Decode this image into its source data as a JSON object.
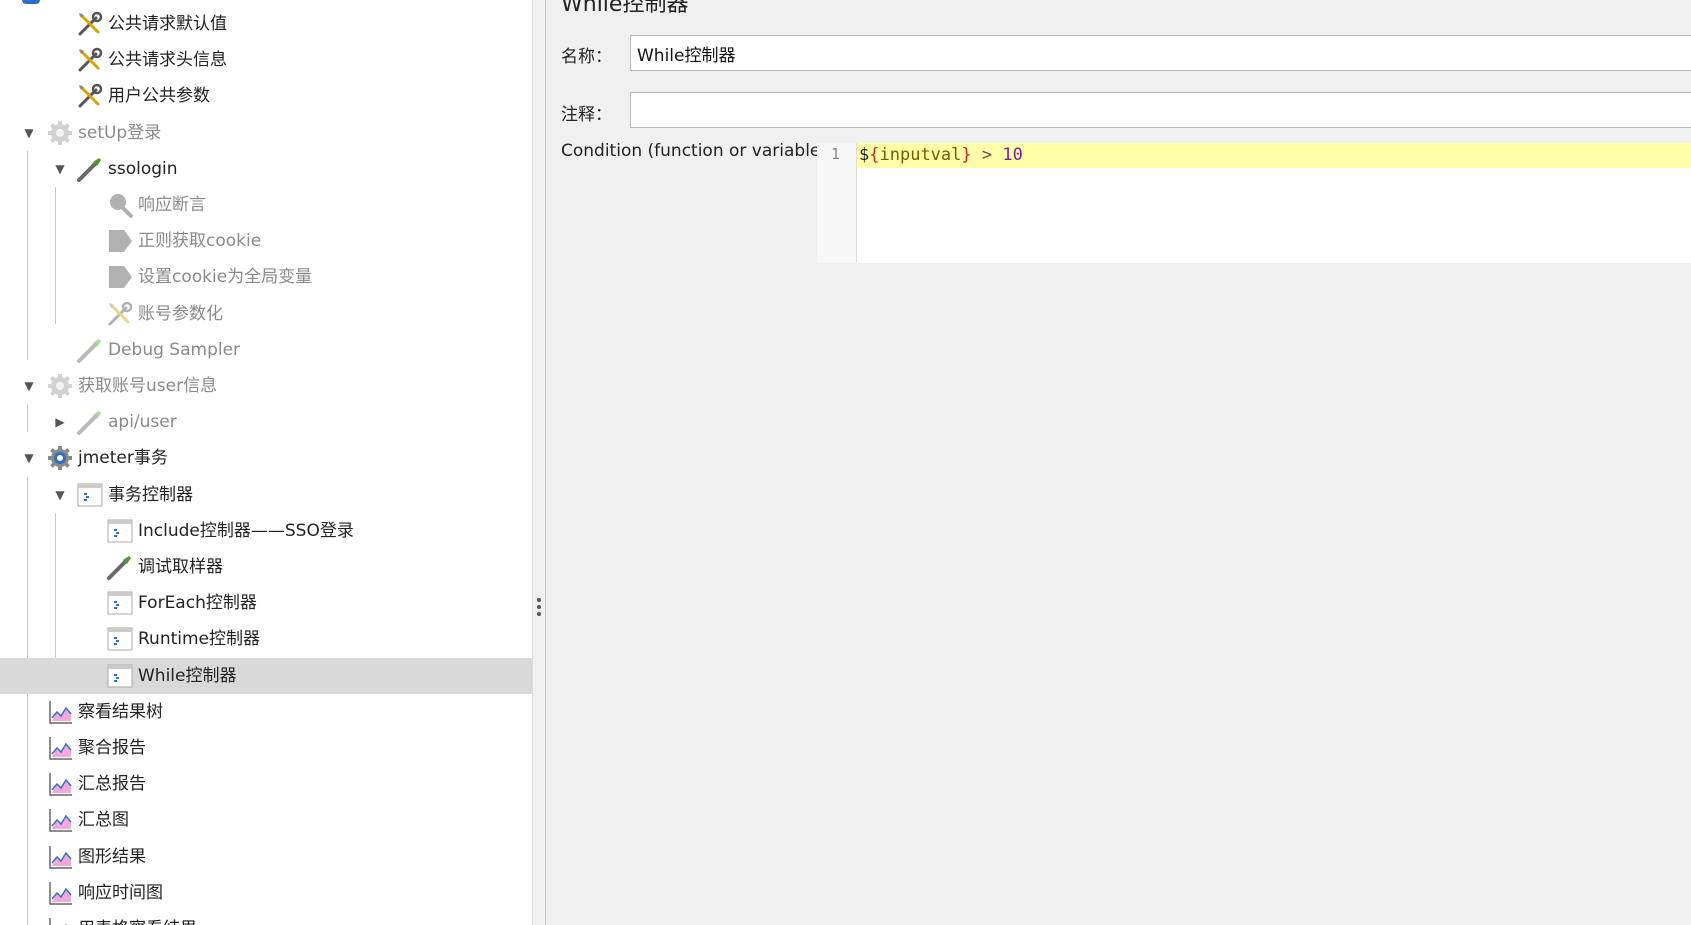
{
  "tree": {
    "nodes": [
      {
        "label": "公共请求默认值",
        "icon": "wrench-screwdriver-icon",
        "level": 1
      },
      {
        "label": "公共请求头信息",
        "icon": "wrench-screwdriver-icon",
        "level": 1
      },
      {
        "label": "用户公共参数",
        "icon": "wrench-screwdriver-icon",
        "level": 1
      },
      {
        "label": "setUp登录",
        "icon": "gear-icon",
        "level": 0,
        "expanded": true,
        "disabled": true
      },
      {
        "label": "ssologin",
        "icon": "pipette-icon",
        "level": 1,
        "expanded": true
      },
      {
        "label": "响应断言",
        "icon": "magnifier-icon",
        "level": 2,
        "disabled": true
      },
      {
        "label": "正则获取cookie",
        "icon": "tag-icon",
        "level": 2,
        "disabled": true
      },
      {
        "label": "设置cookie为全局变量",
        "icon": "tag-icon",
        "level": 2,
        "disabled": true
      },
      {
        "label": "账号参数化",
        "icon": "wrench-screwdriver-icon",
        "level": 2,
        "disabled": true
      },
      {
        "label": "Debug Sampler",
        "icon": "pipette-icon",
        "level": 1,
        "disabled": true
      },
      {
        "label": "获取账号user信息",
        "icon": "gear-icon",
        "level": 0,
        "expanded": true,
        "disabled": true
      },
      {
        "label": "api/user",
        "icon": "pipette-icon",
        "level": 1,
        "collapsed": true,
        "disabled": true
      },
      {
        "label": "jmeter事务",
        "icon": "gear-icon",
        "level": 0,
        "expanded": true
      },
      {
        "label": "事务控制器",
        "icon": "controller-icon",
        "level": 1,
        "expanded": true
      },
      {
        "label": "Include控制器——SSO登录",
        "icon": "controller-icon",
        "level": 2
      },
      {
        "label": "调试取样器",
        "icon": "pipette-icon",
        "level": 2
      },
      {
        "label": "ForEach控制器",
        "icon": "controller-icon",
        "level": 2
      },
      {
        "label": "Runtime控制器",
        "icon": "controller-icon",
        "level": 2
      },
      {
        "label": "While控制器",
        "icon": "controller-icon",
        "level": 2,
        "selected": true
      },
      {
        "label": "察看结果树",
        "icon": "graph-icon",
        "level": 0
      },
      {
        "label": "聚合报告",
        "icon": "graph-icon",
        "level": 0
      },
      {
        "label": "汇总报告",
        "icon": "graph-icon",
        "level": 0
      },
      {
        "label": "汇总图",
        "icon": "graph-icon",
        "level": 0
      },
      {
        "label": "图形结果",
        "icon": "graph-icon",
        "level": 0
      },
      {
        "label": "响应时间图",
        "icon": "graph-icon",
        "level": 0
      },
      {
        "label": "用表格察看结果",
        "icon": "graph-icon",
        "level": 0
      }
    ]
  },
  "editor": {
    "title": "While控制器",
    "name_label": "名称：",
    "name_value": "While控制器",
    "comment_label": "注释：",
    "comment_value": "",
    "condition_label": "Condition (function or variable)",
    "code": {
      "line_number": "1",
      "dollar": "$",
      "brace_open": "{",
      "variable": "inputval",
      "brace_close": "}",
      "operator": " > ",
      "number": "10"
    }
  },
  "colors": {
    "selected_row": "#d9d9d9",
    "code_highlight": "#ffffa8",
    "disabled_text": "#8a8a8a"
  }
}
